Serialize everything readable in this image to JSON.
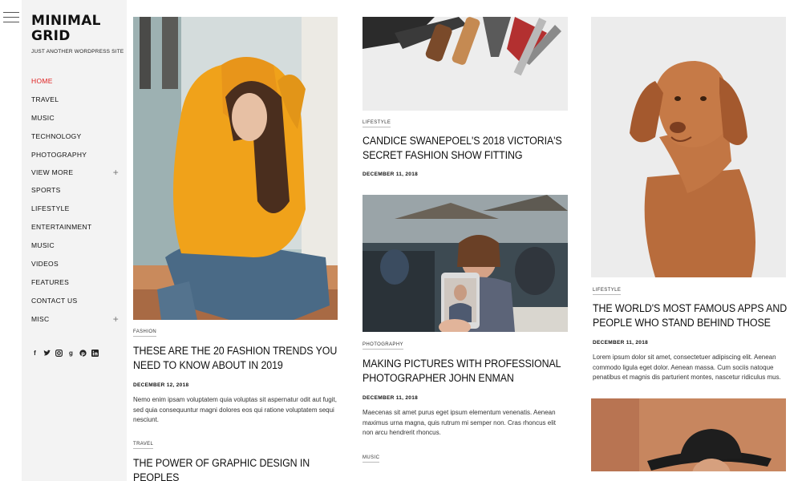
{
  "site": {
    "title": "MINIMAL GRID",
    "tagline": "JUST ANOTHER WORDPRESS SITE"
  },
  "menu": [
    {
      "label": "HOME",
      "active": true,
      "expandable": false
    },
    {
      "label": "TRAVEL",
      "active": false,
      "expandable": false
    },
    {
      "label": "MUSIC",
      "active": false,
      "expandable": false
    },
    {
      "label": "TECHNOLOGY",
      "active": false,
      "expandable": false
    },
    {
      "label": "PHOTOGRAPHY",
      "active": false,
      "expandable": false
    },
    {
      "label": "VIEW MORE",
      "active": false,
      "expandable": true
    },
    {
      "label": "SPORTS",
      "active": false,
      "expandable": false
    },
    {
      "label": "LIFESTYLE",
      "active": false,
      "expandable": false
    },
    {
      "label": "ENTERTAINMENT",
      "active": false,
      "expandable": false
    },
    {
      "label": "MUSIC",
      "active": false,
      "expandable": false
    },
    {
      "label": "VIDEOS",
      "active": false,
      "expandable": false
    },
    {
      "label": "FEATURES",
      "active": false,
      "expandable": false
    },
    {
      "label": "CONTACT US",
      "active": false,
      "expandable": false
    },
    {
      "label": "MISC",
      "active": false,
      "expandable": true
    }
  ],
  "social_icons": [
    "facebook-icon",
    "twitter-icon",
    "instagram-icon",
    "google-plus-icon",
    "pinterest-icon",
    "linkedin-icon"
  ],
  "posts": {
    "fashion": {
      "category": "FASHION",
      "title": "THESE ARE THE 20 FASHION TRENDS YOU NEED TO KNOW ABOUT IN 2019",
      "date": "DECEMBER 12, 2018",
      "excerpt": "Nemo enim ipsam voluptatem quia voluptas sit aspernatur odit aut fugit, sed quia consequuntur magni dolores eos qui ratione voluptatem sequi nesciunt."
    },
    "travel": {
      "category": "TRAVEL",
      "title": "THE POWER OF GRAPHIC DESIGN IN PEOPLES"
    },
    "victoria": {
      "category": "LIFESTYLE",
      "title": "CANDICE SWANEPOEL'S 2018 VICTORIA'S SECRET FASHION SHOW FITTING",
      "date": "DECEMBER 11, 2018"
    },
    "photographer": {
      "category": "PHOTOGRAPHY",
      "title": "MAKING PICTURES WITH PROFESSIONAL PHOTOGRAPHER JOHN ENMAN",
      "date": "DECEMBER 11, 2018",
      "excerpt": "Maecenas sit amet purus eget ipsum elementum venenatis. Aenean maximus urna magna, quis rutrum mi semper non. Cras rhoncus elit non arcu hendrerit rhoncus."
    },
    "music": {
      "category": "MUSIC"
    },
    "apps": {
      "category": "LIFESTYLE",
      "title": "THE WORLD'S MOST FAMOUS APPS AND PEOPLE WHO STAND BEHIND THOSE",
      "date": "DECEMBER 11, 2018",
      "excerpt": "Lorem ipsum dolor sit amet, consectetuer adipiscing elit. Aenean commodo ligula eget dolor. Aenean massa. Cum sociis natoque penatibus et magnis dis parturient montes, nascetur ridiculus mus."
    }
  },
  "colors": {
    "accent": "#e02020",
    "sidebar_bg": "#f3f3f3",
    "hoodie": "#f0a21a"
  }
}
